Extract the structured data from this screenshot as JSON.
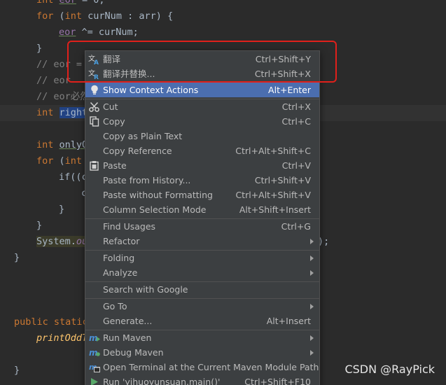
{
  "editor": {
    "lines": {
      "l0": [
        "int",
        " ",
        "eor",
        " = 0;"
      ],
      "l1": [
        "for",
        " (",
        "int",
        " curNum : arr) {"
      ],
      "l2": [
        "eor",
        " ^= curNum;"
      ],
      "l3": "}",
      "l4": "// eor =",
      "l5": "// eor",
      "l6": "// eor必然",
      "l7": [
        "int",
        " ",
        "right"
      ],
      "l8": [
        "int",
        " ",
        "onlyO"
      ],
      "l9": [
        "for",
        " (",
        "int"
      ],
      "l10": "if((c",
      "l11": "c",
      "l12": "}",
      "l13": "}",
      "l14": [
        "System.",
        "ou",
        ");"
      ],
      "l15": "}",
      "l16": [
        "public",
        " ",
        "static"
      ],
      "l17": "printOddT",
      "l18": "}"
    }
  },
  "menu": {
    "items": [
      {
        "label": "翻译",
        "shortcut": "Ctrl+Shift+Y",
        "icon": "translate-icon"
      },
      {
        "label": "翻译并替换...",
        "shortcut": "Ctrl+Shift+X",
        "icon": "translate-replace-icon"
      },
      {
        "label": "Show Context Actions",
        "shortcut": "Alt+Enter",
        "icon": "lightbulb-icon"
      },
      {
        "label": "Cut",
        "shortcut": "Ctrl+X",
        "icon": "scissors-icon"
      },
      {
        "label": "Copy",
        "shortcut": "Ctrl+C",
        "icon": "copy-icon"
      },
      {
        "label": "Copy as Plain Text",
        "shortcut": ""
      },
      {
        "label": "Copy Reference",
        "shortcut": "Ctrl+Alt+Shift+C"
      },
      {
        "label": "Paste",
        "shortcut": "Ctrl+V",
        "icon": "clipboard-icon"
      },
      {
        "label": "Paste from History...",
        "shortcut": "Ctrl+Shift+V"
      },
      {
        "label": "Paste without Formatting",
        "shortcut": "Ctrl+Alt+Shift+V"
      },
      {
        "label": "Column Selection Mode",
        "shortcut": "Alt+Shift+Insert"
      },
      {
        "label": "Find Usages",
        "shortcut": "Ctrl+G"
      },
      {
        "label": "Refactor",
        "shortcut": ""
      },
      {
        "label": "Folding",
        "shortcut": ""
      },
      {
        "label": "Analyze",
        "shortcut": ""
      },
      {
        "label": "Search with Google",
        "shortcut": ""
      },
      {
        "label": "Go To",
        "shortcut": ""
      },
      {
        "label": "Generate...",
        "shortcut": "Alt+Insert"
      },
      {
        "label": "Run Maven",
        "shortcut": "",
        "icon": "maven-icon"
      },
      {
        "label": "Debug Maven",
        "shortcut": "",
        "icon": "maven-debug-icon"
      },
      {
        "label": "Open Terminal at the Current Maven Module Path",
        "shortcut": "",
        "icon": "terminal-icon"
      },
      {
        "label": "Run 'yihuoyunsuan.main()'",
        "shortcut": "Ctrl+Shift+F10",
        "icon": "run-icon"
      }
    ]
  },
  "colors": {
    "editor_bg": "#2b2b2b",
    "menu_bg": "#3c3f41",
    "highlight": "#4b6eaf",
    "keyword": "#cc7832",
    "annotation": "#e0201b"
  },
  "watermark": "CSDN @RayPick"
}
